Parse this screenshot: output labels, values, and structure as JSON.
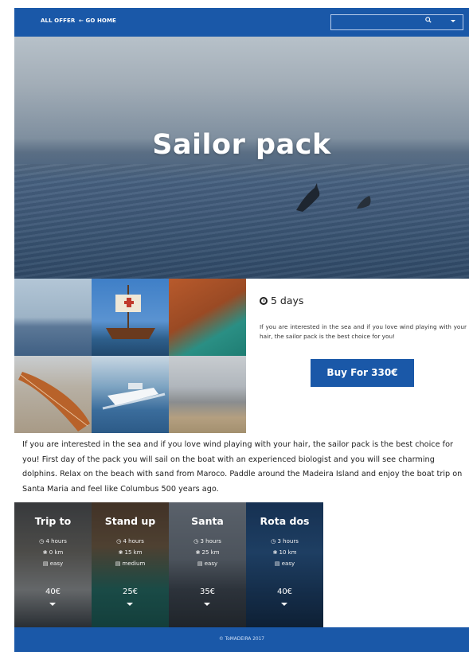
{
  "nav": {
    "all_offer": "ALL OFFER",
    "go_home": "GO HOME",
    "search_placeholder": ""
  },
  "hero": {
    "title": "Sailor pack"
  },
  "info": {
    "duration": "5 days",
    "short_description": "If you are interested in the sea and if you love wind playing with your hair, the sailor pack is the best choice for you!",
    "buy_label": "Buy For 330€"
  },
  "long_description": "If you are interested in the sea and if you love wind playing with your hair, the sailor pack is the best choice for you! First day of the pack you will sail on the boat with an experienced biologist and you will see charming dolphins. Relax on the beach with sand from Maroco. Paddle around the Madeira Island and enjoy the boat trip on Santa Maria and feel like Columbus 500 years ago.",
  "tours": [
    {
      "title": "Trip to",
      "time": "4 hours",
      "distance": "0 km",
      "difficulty": "easy",
      "price": "40€"
    },
    {
      "title": "Stand up",
      "time": "4 hours",
      "distance": "15 km",
      "difficulty": "medium",
      "price": "25€"
    },
    {
      "title": "Santa",
      "time": "3 hours",
      "distance": "25 km",
      "difficulty": "easy",
      "price": "35€"
    },
    {
      "title": "Rota dos",
      "time": "3 hours",
      "distance": "10 km",
      "difficulty": "easy",
      "price": "40€"
    }
  ],
  "footer": {
    "copyright": "© ToMADEIRA 2017"
  },
  "colors": {
    "brand": "#1a58a8",
    "text": "#222222"
  }
}
